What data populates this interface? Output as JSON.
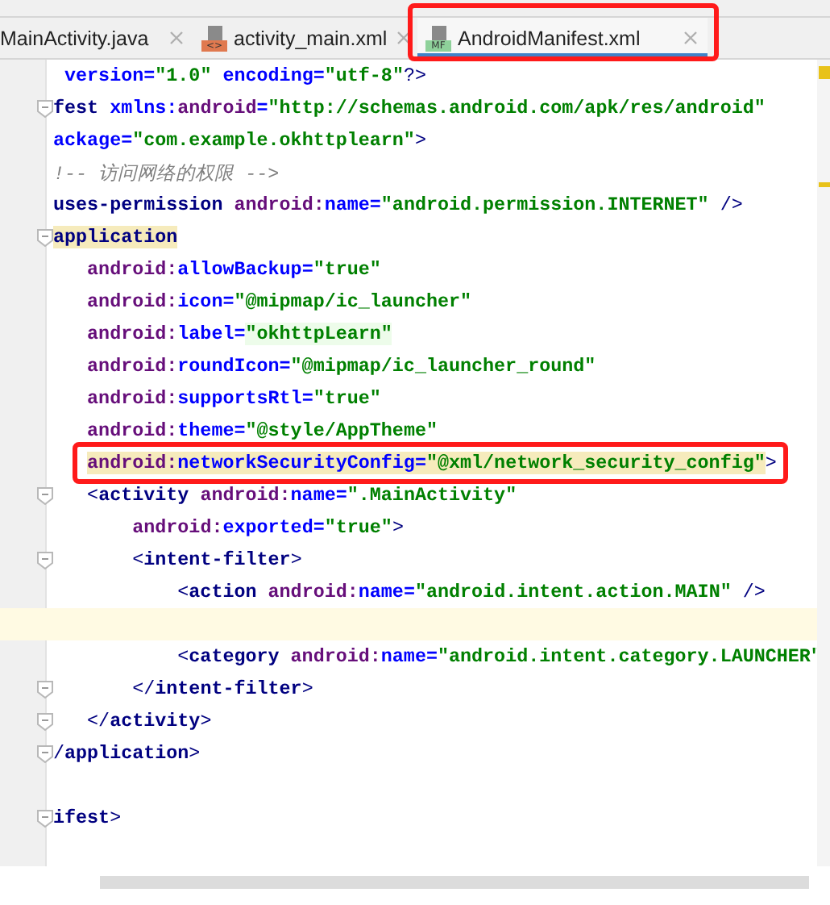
{
  "tabs": [
    {
      "label": "MainActivity.java",
      "selected": false
    },
    {
      "label": "activity_main.xml",
      "selected": false,
      "badge": "<>",
      "color": "#e0794f"
    },
    {
      "label": "AndroidManifest.xml",
      "selected": true,
      "badge": "MF",
      "color": "#8ed19a"
    }
  ],
  "lines": [
    {
      "current": false,
      "fold": false,
      "tokens": [
        {
          "kind": "attr",
          "text": " version"
        },
        {
          "kind": "eq",
          "text": "="
        },
        {
          "kind": "value",
          "text": "\"1.0\""
        },
        {
          "kind": "attr",
          "text": " encoding"
        },
        {
          "kind": "eq",
          "text": "="
        },
        {
          "kind": "value",
          "text": "\"utf-8\""
        },
        {
          "kind": "punct",
          "text": "?>"
        }
      ]
    },
    {
      "current": false,
      "fold": true,
      "tokens": [
        {
          "kind": "tag",
          "text": "fest"
        },
        {
          "kind": "attr",
          "text": " xmlns:"
        },
        {
          "kind": "ns",
          "text": "android"
        },
        {
          "kind": "eq",
          "text": "="
        },
        {
          "kind": "value",
          "text": "\"http://schemas.android.com/apk/res/android\""
        }
      ]
    },
    {
      "current": false,
      "fold": false,
      "tokens": [
        {
          "kind": "attr",
          "text": "ackage"
        },
        {
          "kind": "eq",
          "text": "="
        },
        {
          "kind": "value",
          "text": "\"com.example.okhttplearn\""
        },
        {
          "kind": "punct",
          "text": ">"
        }
      ]
    },
    {
      "current": false,
      "fold": false,
      "tokens": [
        {
          "kind": "comment",
          "text": "!-- 访问网络的权限 -->"
        }
      ]
    },
    {
      "current": false,
      "fold": false,
      "tokens": [
        {
          "kind": "tag",
          "text": "uses-permission"
        },
        {
          "kind": "ns",
          "text": " android:"
        },
        {
          "kind": "attr",
          "text": "name"
        },
        {
          "kind": "eq",
          "text": "="
        },
        {
          "kind": "value",
          "text": "\"android.permission.INTERNET\""
        },
        {
          "kind": "punct",
          "text": " />"
        }
      ]
    },
    {
      "current": false,
      "fold": true,
      "tokens": [
        {
          "kind": "tag",
          "text": "application",
          "color": "#f6ebbc"
        }
      ]
    },
    {
      "current": false,
      "fold": false,
      "tokens": [
        {
          "kind": "ns",
          "text": "   android:"
        },
        {
          "kind": "attr",
          "text": "allowBackup"
        },
        {
          "kind": "eq",
          "text": "="
        },
        {
          "kind": "value",
          "text": "\"true\""
        }
      ]
    },
    {
      "current": false,
      "fold": false,
      "tokens": [
        {
          "kind": "ns",
          "text": "   android:"
        },
        {
          "kind": "attr",
          "text": "icon"
        },
        {
          "kind": "eq",
          "text": "="
        },
        {
          "kind": "value",
          "text": "\"@mipmap/ic_launcher\""
        }
      ]
    },
    {
      "current": false,
      "fold": false,
      "tokens": [
        {
          "kind": "ns",
          "text": "   android:"
        },
        {
          "kind": "attr",
          "text": "label"
        },
        {
          "kind": "eq",
          "text": "="
        },
        {
          "kind": "value",
          "text": "\"okhttpLearn\"",
          "color": "#edfcea"
        }
      ]
    },
    {
      "current": false,
      "fold": false,
      "tokens": [
        {
          "kind": "ns",
          "text": "   android:"
        },
        {
          "kind": "attr",
          "text": "roundIcon"
        },
        {
          "kind": "eq",
          "text": "="
        },
        {
          "kind": "value",
          "text": "\"@mipmap/ic_launcher_round\""
        }
      ]
    },
    {
      "current": false,
      "fold": false,
      "tokens": [
        {
          "kind": "ns",
          "text": "   android:"
        },
        {
          "kind": "attr",
          "text": "supportsRtl"
        },
        {
          "kind": "eq",
          "text": "="
        },
        {
          "kind": "value",
          "text": "\"true\""
        }
      ]
    },
    {
      "current": false,
      "fold": false,
      "tokens": [
        {
          "kind": "ns",
          "text": "   android:"
        },
        {
          "kind": "attr",
          "text": "theme"
        },
        {
          "kind": "eq",
          "text": "="
        },
        {
          "kind": "value",
          "text": "\"@style/AppTheme\""
        }
      ]
    },
    {
      "current": false,
      "fold": false,
      "tokens": [
        {
          "kind": "ns",
          "text": "   android:",
          "color": "#f6ebbc"
        },
        {
          "kind": "attr",
          "text": "networkSecurityConfig",
          "color": "#f6ebbc"
        },
        {
          "kind": "eq",
          "text": "=",
          "color": "#f6ebbc"
        },
        {
          "kind": "value",
          "text": "\"@xml/network_security_config\"",
          "color": "#f6ebbc"
        },
        {
          "kind": "punct",
          "text": ">"
        }
      ]
    },
    {
      "current": false,
      "fold": true,
      "tokens": [
        {
          "kind": "punct",
          "text": "   <"
        },
        {
          "kind": "tag",
          "text": "activity"
        },
        {
          "kind": "ns",
          "text": " android:"
        },
        {
          "kind": "attr",
          "text": "name"
        },
        {
          "kind": "eq",
          "text": "="
        },
        {
          "kind": "value",
          "text": "\".MainActivity\""
        }
      ]
    },
    {
      "current": false,
      "fold": false,
      "tokens": [
        {
          "kind": "ns",
          "text": "       android:"
        },
        {
          "kind": "attr",
          "text": "exported"
        },
        {
          "kind": "eq",
          "text": "="
        },
        {
          "kind": "value",
          "text": "\"true\""
        },
        {
          "kind": "punct",
          "text": ">"
        }
      ]
    },
    {
      "current": false,
      "fold": true,
      "tokens": [
        {
          "kind": "punct",
          "text": "       <"
        },
        {
          "kind": "tag",
          "text": "intent-filter"
        },
        {
          "kind": "punct",
          "text": ">"
        }
      ]
    },
    {
      "current": false,
      "fold": false,
      "tokens": [
        {
          "kind": "punct",
          "text": "           <"
        },
        {
          "kind": "tag",
          "text": "action"
        },
        {
          "kind": "ns",
          "text": " android:"
        },
        {
          "kind": "attr",
          "text": "name"
        },
        {
          "kind": "eq",
          "text": "="
        },
        {
          "kind": "value",
          "text": "\"android.intent.action.MAIN\""
        },
        {
          "kind": "punct",
          "text": " />"
        }
      ]
    },
    {
      "current": true,
      "fold": false
    },
    {
      "current": false,
      "fold": false,
      "tokens": [
        {
          "kind": "punct",
          "text": "           <"
        },
        {
          "kind": "tag",
          "text": "category"
        },
        {
          "kind": "ns",
          "text": " android:"
        },
        {
          "kind": "attr",
          "text": "name"
        },
        {
          "kind": "eq",
          "text": "="
        },
        {
          "kind": "value",
          "text": "\"android.intent.category.LAUNCHER\""
        }
      ]
    },
    {
      "current": false,
      "fold": true,
      "tokens": [
        {
          "kind": "punct",
          "text": "       </"
        },
        {
          "kind": "tag",
          "text": "intent-filter"
        },
        {
          "kind": "punct",
          "text": ">"
        }
      ]
    },
    {
      "current": false,
      "fold": true,
      "tokens": [
        {
          "kind": "punct",
          "text": "   </"
        },
        {
          "kind": "tag",
          "text": "activity"
        },
        {
          "kind": "punct",
          "text": ">"
        }
      ]
    },
    {
      "current": false,
      "fold": true,
      "tokens": [
        {
          "kind": "punct",
          "text": "/"
        },
        {
          "kind": "tag",
          "text": "application"
        },
        {
          "kind": "punct",
          "text": ">"
        }
      ]
    },
    {
      "current": false,
      "fold": false
    },
    {
      "current": false,
      "fold": true,
      "tokens": [
        {
          "kind": "tag",
          "text": "ifest"
        },
        {
          "kind": "punct",
          "text": ">"
        }
      ]
    },
    {
      "current": false,
      "fold": false
    }
  ]
}
